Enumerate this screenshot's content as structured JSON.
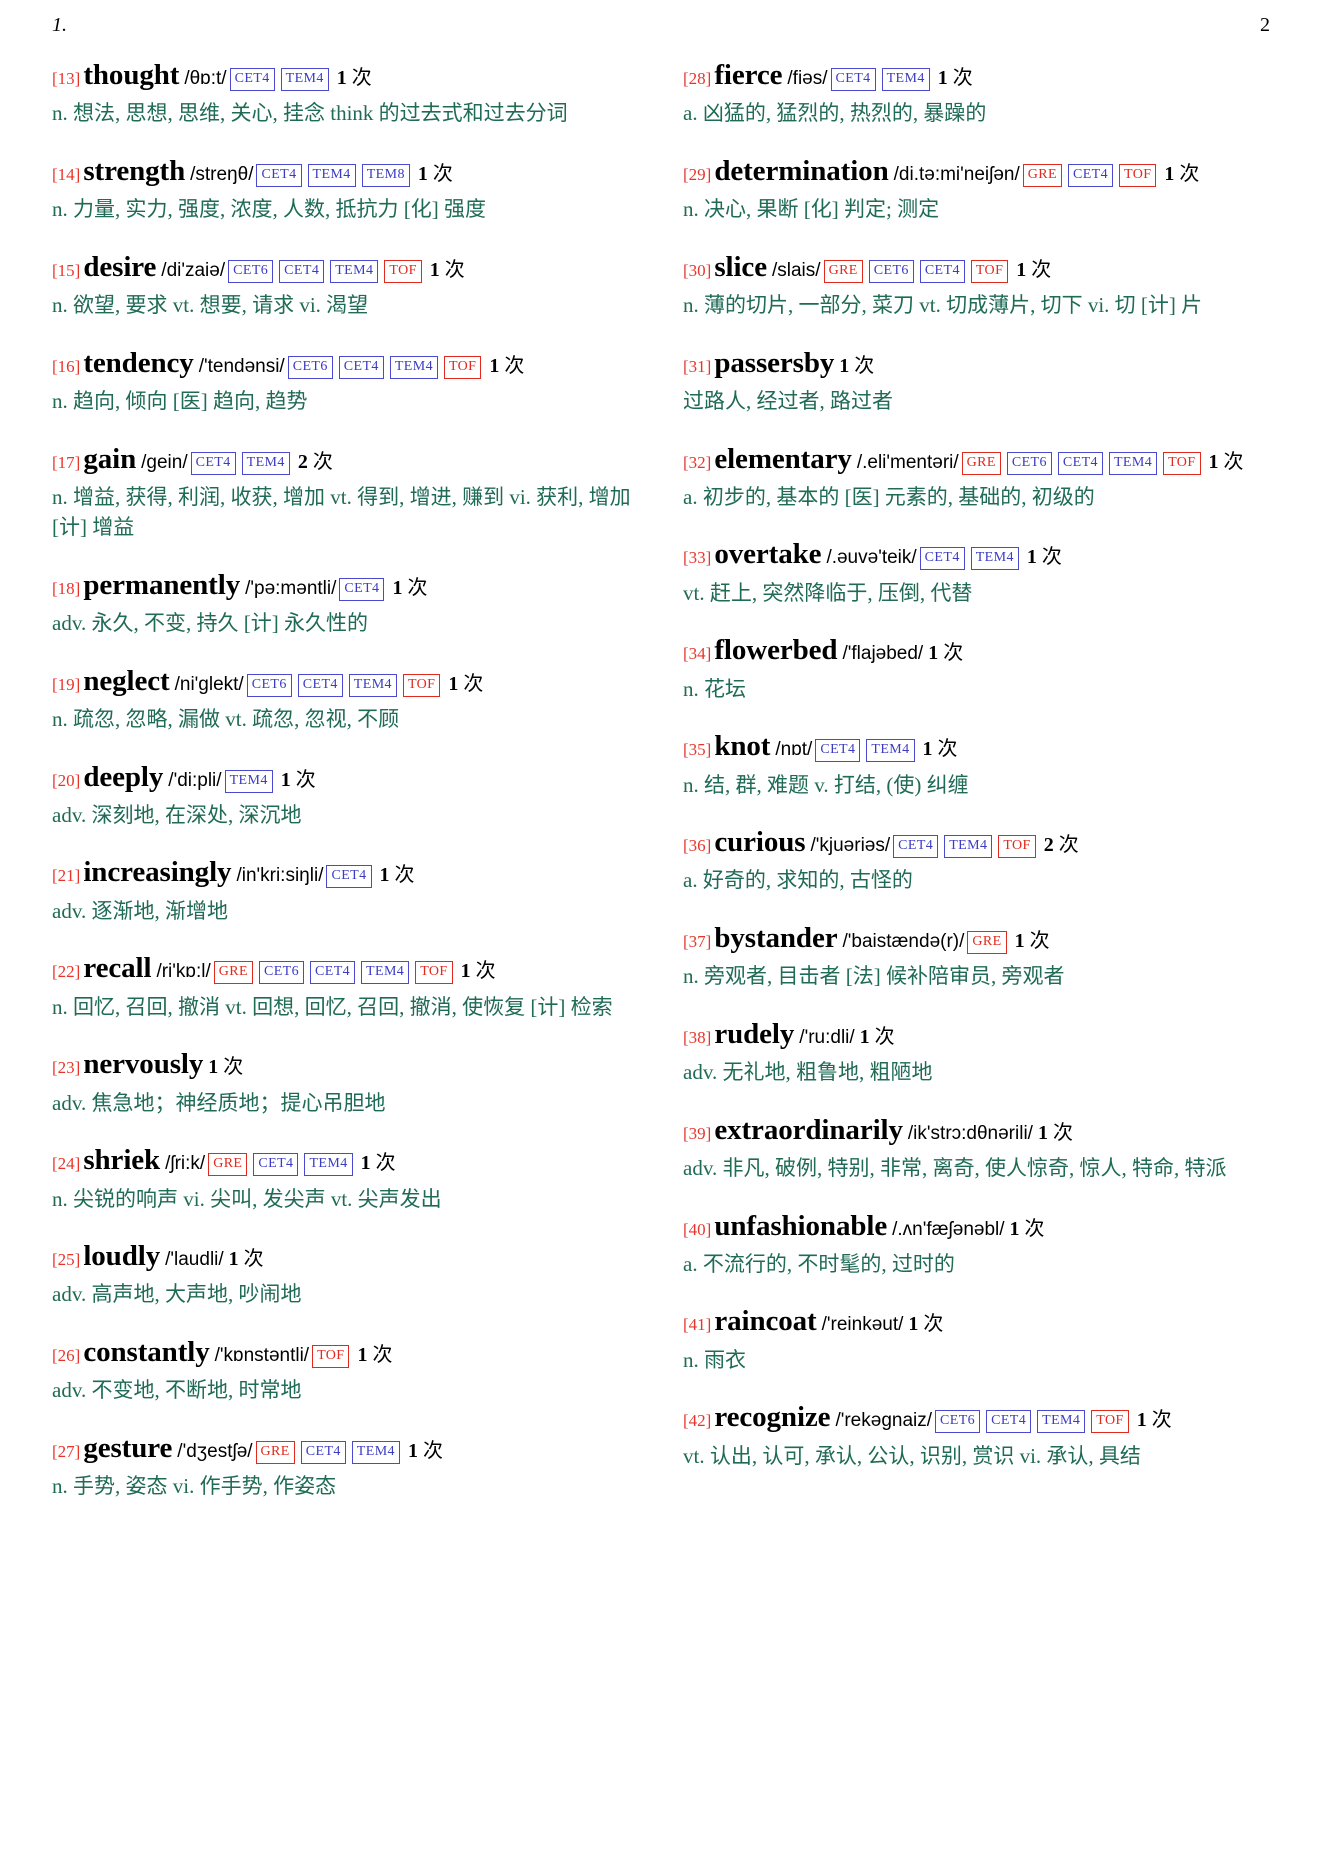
{
  "running_head": {
    "left": "1.",
    "right": "2"
  },
  "labels": {
    "count_unit": "次"
  },
  "columns": [
    {
      "entries": [
        {
          "index": "[13]",
          "word": "thought",
          "ipa": "/θɒ:t/",
          "tags": [
            {
              "text": "CET4",
              "color": "blue"
            },
            {
              "text": "TEM4",
              "color": "blue"
            }
          ],
          "count": "1",
          "definition": "n. 想法, 思想, 思维, 关心, 挂念 think 的过去式和过去分词"
        },
        {
          "index": "[14]",
          "word": "strength",
          "ipa": "/streŋθ/",
          "tags": [
            {
              "text": "CET4",
              "color": "blue"
            },
            {
              "text": "TEM4",
              "color": "blue"
            },
            {
              "text": "TEM8",
              "color": "blue"
            }
          ],
          "count": "1",
          "definition": "n. 力量, 实力, 强度, 浓度, 人数, 抵抗力 [化] 强度"
        },
        {
          "index": "[15]",
          "word": "desire",
          "ipa": "/di'zaiə/",
          "tags": [
            {
              "text": "CET6",
              "color": "blue"
            },
            {
              "text": "CET4",
              "color": "blue"
            },
            {
              "text": "TEM4",
              "color": "blue"
            },
            {
              "text": "TOF",
              "color": "red"
            }
          ],
          "count": "1",
          "definition": "n. 欲望, 要求 vt. 想要, 请求 vi. 渴望"
        },
        {
          "index": "[16]",
          "word": "tendency",
          "ipa": "/'tendənsi/",
          "tags": [
            {
              "text": "CET6",
              "color": "blue"
            },
            {
              "text": "CET4",
              "color": "blue"
            },
            {
              "text": "TEM4",
              "color": "blue"
            },
            {
              "text": "TOF",
              "color": "red"
            }
          ],
          "count": "1",
          "definition": "n. 趋向, 倾向 [医] 趋向, 趋势"
        },
        {
          "index": "[17]",
          "word": "gain",
          "ipa": "/gein/",
          "tags": [
            {
              "text": "CET4",
              "color": "blue"
            },
            {
              "text": "TEM4",
              "color": "blue"
            }
          ],
          "count": "2",
          "definition": "n. 增益, 获得, 利润, 收获, 增加 vt. 得到, 增进, 赚到 vi. 获利, 增加 [计] 增益"
        },
        {
          "index": "[18]",
          "word": "permanently",
          "ipa": "/'pə:məntli/",
          "tags": [
            {
              "text": "CET4",
              "color": "blue"
            }
          ],
          "count": "1",
          "definition": "adv. 永久, 不变, 持久 [计] 永久性的"
        },
        {
          "index": "[19]",
          "word": "neglect",
          "ipa": "/ni'glekt/",
          "tags": [
            {
              "text": "CET6",
              "color": "blue"
            },
            {
              "text": "CET4",
              "color": "blue"
            },
            {
              "text": "TEM4",
              "color": "blue"
            },
            {
              "text": "TOF",
              "color": "red"
            }
          ],
          "count": "1",
          "definition": "n. 疏忽, 忽略, 漏做 vt. 疏忽, 忽视, 不顾"
        },
        {
          "index": "[20]",
          "word": "deeply",
          "ipa": "/'di:pli/",
          "tags": [
            {
              "text": "TEM4",
              "color": "blue"
            }
          ],
          "count": "1",
          "definition": "adv. 深刻地, 在深处, 深沉地"
        },
        {
          "index": "[21]",
          "word": "increasingly",
          "ipa": "/in'kri:siŋli/",
          "tags": [
            {
              "text": "CET4",
              "color": "blue"
            }
          ],
          "count": "1",
          "definition": "adv. 逐渐地, 渐增地"
        },
        {
          "index": "[22]",
          "word": "recall",
          "ipa": "/ri'kɒ:l/",
          "tags": [
            {
              "text": "GRE",
              "color": "red"
            },
            {
              "text": "CET6",
              "color": "blue"
            },
            {
              "text": "CET4",
              "color": "blue"
            },
            {
              "text": "TEM4",
              "color": "blue"
            },
            {
              "text": "TOF",
              "color": "red"
            }
          ],
          "count": "1",
          "definition": "n. 回忆, 召回, 撤消 vt. 回想, 回忆, 召回, 撤消, 使恢复 [计] 检索"
        },
        {
          "index": "[23]",
          "word": "nervously",
          "ipa": "",
          "tags": [],
          "count": "1",
          "definition": "adv. 焦急地；神经质地；提心吊胆地"
        },
        {
          "index": "[24]",
          "word": "shriek",
          "ipa": "/ʃri:k/",
          "tags": [
            {
              "text": "GRE",
              "color": "red"
            },
            {
              "text": "CET4",
              "color": "blue"
            },
            {
              "text": "TEM4",
              "color": "blue"
            }
          ],
          "count": "1",
          "definition": "n. 尖锐的响声 vi. 尖叫, 发尖声 vt. 尖声发出"
        },
        {
          "index": "[25]",
          "word": "loudly",
          "ipa": "/'laudli/",
          "tags": [],
          "count": "1",
          "definition": "adv. 高声地, 大声地, 吵闹地"
        },
        {
          "index": "[26]",
          "word": "constantly",
          "ipa": "/'kɒnstəntli/",
          "tags": [
            {
              "text": "TOF",
              "color": "red"
            }
          ],
          "count": "1",
          "definition": "adv. 不变地, 不断地, 时常地"
        },
        {
          "index": "[27]",
          "word": "gesture",
          "ipa": "/'dʒestʃə/",
          "tags": [
            {
              "text": "GRE",
              "color": "red"
            },
            {
              "text": "CET4",
              "color": "blue"
            },
            {
              "text": "TEM4",
              "color": "blue"
            }
          ],
          "count": "1",
          "definition": "n. 手势, 姿态 vi. 作手势, 作姿态"
        }
      ]
    },
    {
      "entries": [
        {
          "index": "[28]",
          "word": "fierce",
          "ipa": "/fiəs/",
          "tags": [
            {
              "text": "CET4",
              "color": "blue"
            },
            {
              "text": "TEM4",
              "color": "blue"
            }
          ],
          "count": "1",
          "definition": "a. 凶猛的, 猛烈的, 热烈的, 暴躁的"
        },
        {
          "index": "[29]",
          "word": "determination",
          "ipa": "/di.tə:mi'neiʃən/",
          "tags": [
            {
              "text": "GRE",
              "color": "red"
            },
            {
              "text": "CET4",
              "color": "blue"
            },
            {
              "text": "TOF",
              "color": "red"
            }
          ],
          "count": "1",
          "definition": "n. 决心, 果断 [化] 判定; 测定"
        },
        {
          "index": "[30]",
          "word": "slice",
          "ipa": "/slais/",
          "tags": [
            {
              "text": "GRE",
              "color": "red"
            },
            {
              "text": "CET6",
              "color": "blue"
            },
            {
              "text": "CET4",
              "color": "blue"
            },
            {
              "text": "TOF",
              "color": "red"
            }
          ],
          "count": "1",
          "definition": "n. 薄的切片, 一部分, 菜刀 vt. 切成薄片, 切下 vi. 切 [计] 片"
        },
        {
          "index": "[31]",
          "word": "passersby",
          "ipa": "",
          "tags": [],
          "count": "1",
          "definition": "过路人, 经过者, 路过者"
        },
        {
          "index": "[32]",
          "word": "elementary",
          "ipa": "/.eli'mentəri/",
          "tags": [
            {
              "text": "GRE",
              "color": "red"
            },
            {
              "text": "CET6",
              "color": "blue"
            },
            {
              "text": "CET4",
              "color": "blue"
            },
            {
              "text": "TEM4",
              "color": "blue"
            },
            {
              "text": "TOF",
              "color": "red"
            }
          ],
          "count": "1",
          "definition": "a. 初步的, 基本的 [医] 元素的, 基础的, 初级的"
        },
        {
          "index": "[33]",
          "word": "overtake",
          "ipa": "/.əuvə'teik/",
          "tags": [
            {
              "text": "CET4",
              "color": "blue"
            },
            {
              "text": "TEM4",
              "color": "blue"
            }
          ],
          "count": "1",
          "definition": "vt. 赶上, 突然降临于, 压倒, 代替"
        },
        {
          "index": "[34]",
          "word": "flowerbed",
          "ipa": "/'flajəbed/",
          "tags": [],
          "count": "1",
          "definition": "n. 花坛"
        },
        {
          "index": "[35]",
          "word": "knot",
          "ipa": "/nɒt/",
          "tags": [
            {
              "text": "CET4",
              "color": "blue"
            },
            {
              "text": "TEM4",
              "color": "blue"
            }
          ],
          "count": "1",
          "definition": "n. 结, 群, 难题 v. 打结, (使) 纠缠"
        },
        {
          "index": "[36]",
          "word": "curious",
          "ipa": "/'kjuəriəs/",
          "tags": [
            {
              "text": "CET4",
              "color": "blue"
            },
            {
              "text": "TEM4",
              "color": "blue"
            },
            {
              "text": "TOF",
              "color": "red"
            }
          ],
          "count": "2",
          "definition": "a. 好奇的, 求知的, 古怪的"
        },
        {
          "index": "[37]",
          "word": "bystander",
          "ipa": "/'baistændə(r)/",
          "tags": [
            {
              "text": "GRE",
              "color": "red"
            }
          ],
          "count": "1",
          "definition": "n. 旁观者, 目击者 [法] 候补陪审员, 旁观者"
        },
        {
          "index": "[38]",
          "word": "rudely",
          "ipa": "/'ru:dli/",
          "tags": [],
          "count": "1",
          "definition": "adv. 无礼地, 粗鲁地, 粗陋地"
        },
        {
          "index": "[39]",
          "word": "extraordinarily",
          "ipa": "/ik'strɔ:dθnərili/",
          "tags": [],
          "count": "1",
          "definition": "adv. 非凡, 破例, 特别, 非常, 离奇, 使人惊奇, 惊人, 特命, 特派"
        },
        {
          "index": "[40]",
          "word": "unfashionable",
          "ipa": "/.ʌn'fæʃənəbl/",
          "tags": [],
          "count": "1",
          "definition": "a. 不流行的, 不时髦的, 过时的"
        },
        {
          "index": "[41]",
          "word": "raincoat",
          "ipa": "/'reinkəut/",
          "tags": [],
          "count": "1",
          "definition": "n. 雨衣"
        },
        {
          "index": "[42]",
          "word": "recognize",
          "ipa": "/'rekəgnaiz/",
          "tags": [
            {
              "text": "CET6",
              "color": "blue"
            },
            {
              "text": "CET4",
              "color": "blue"
            },
            {
              "text": "TEM4",
              "color": "blue"
            },
            {
              "text": "TOF",
              "color": "red"
            }
          ],
          "count": "1",
          "definition": "vt. 认出, 认可, 承认, 公认, 识别, 赏识 vi. 承认, 具结"
        }
      ]
    }
  ],
  "colors": {
    "index_red": "#e8352b",
    "tag_blue": "#3b3bc4",
    "tag_red": "#e02a1e",
    "definition_green": "#1f6b55"
  }
}
